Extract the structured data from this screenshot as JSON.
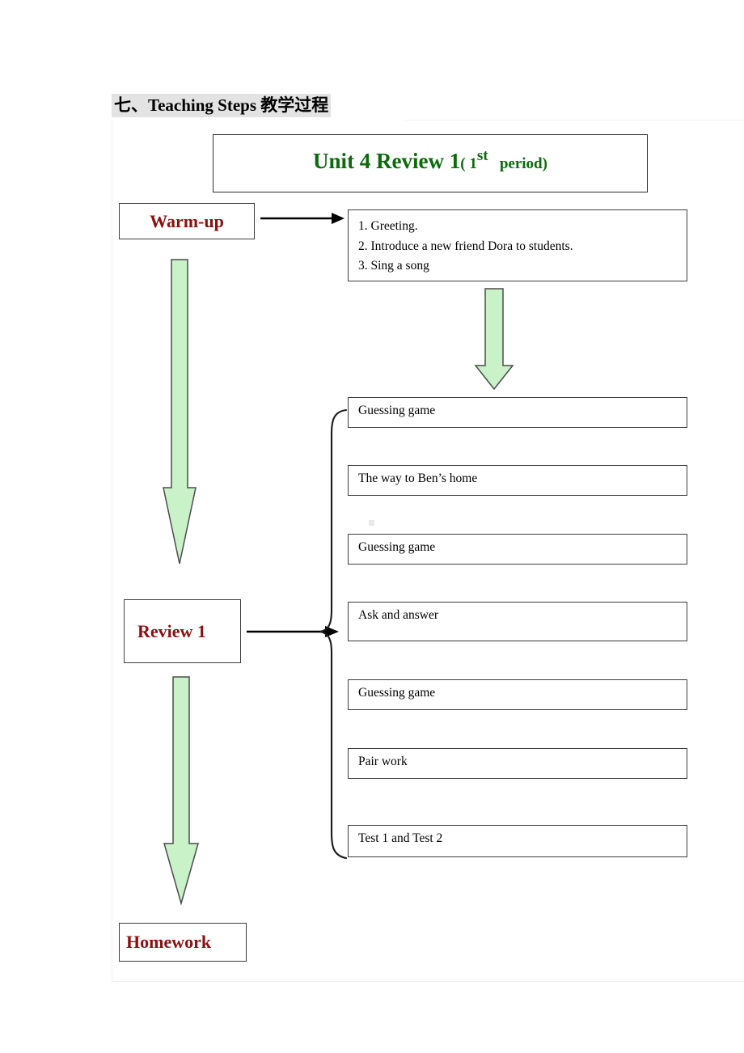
{
  "page": {
    "section_heading": "七、Teaching Steps 教学过程",
    "background_color": "#ffffff"
  },
  "colors": {
    "title_green": "#0a6b0a",
    "stage_red": "#8b1010",
    "arrow_green_fill": "#c9f2c9",
    "arrow_green_stroke": "#4b4b4b",
    "box_border": "#3d3d3d",
    "heading_highlight": "#e3e3e3",
    "connector_black": "#000000"
  },
  "title_box": {
    "main": "Unit 4 Review 1",
    "paren_open": "( 1",
    "superscript": "st",
    "paren_rest": "period)"
  },
  "stages": [
    {
      "name": "warm-up",
      "label": "Warm-up"
    },
    {
      "name": "review-1",
      "label": "Review 1"
    },
    {
      "name": "homework",
      "label": "Homework"
    }
  ],
  "warmup_details": {
    "lines": [
      "1. Greeting.",
      "2. Introduce a new friend Dora to students.",
      "3. Sing a song"
    ]
  },
  "activities": [
    {
      "label": "Guessing game"
    },
    {
      "label": "The way to Ben’s home"
    },
    {
      "label": "Guessing game"
    },
    {
      "label": "Ask and answer"
    },
    {
      "label": "Guessing game"
    },
    {
      "label": "Pair work"
    },
    {
      "label": "Test 1 and Test 2"
    }
  ],
  "connectors": {
    "warmup_arrow": "right-arrow-icon",
    "review_arrow": "right-arrow-icon",
    "brace": "left-curly-brace-icon",
    "down_arrows": [
      "down-arrow-warmup-to-review",
      "down-arrow-details-to-activities",
      "down-arrow-review-to-homework"
    ]
  }
}
